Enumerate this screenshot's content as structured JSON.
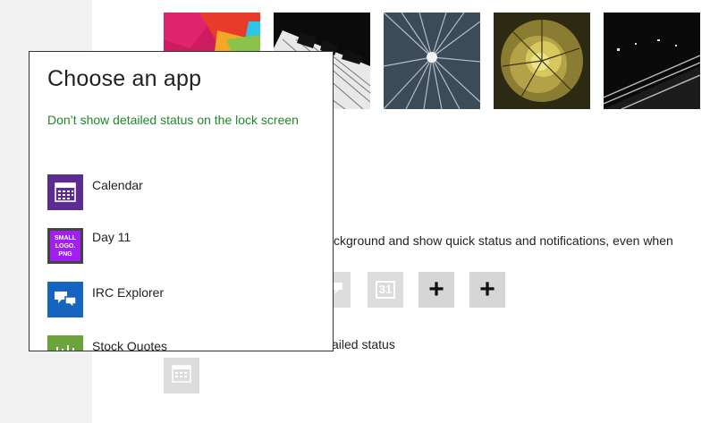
{
  "background": {
    "images": [
      {
        "name": "abstract-shapes"
      },
      {
        "name": "piano-keys"
      },
      {
        "name": "city-light-trails"
      },
      {
        "name": "nautilus-shell"
      },
      {
        "name": "night-road"
      }
    ],
    "description_fragment": "ckground and show quick status and notifications, even when",
    "detailed_status_fragment": "ailed status",
    "quick_status_tiles": [
      {
        "icon": "chat-icon"
      },
      {
        "icon": "calendar-31-icon",
        "label": "31"
      },
      {
        "icon": "plus-icon",
        "label": "+"
      },
      {
        "icon": "plus-icon",
        "label": "+"
      }
    ],
    "detailed_status_tile_icon": "calendar-icon"
  },
  "flyout": {
    "title": "Choose an app",
    "dont_show_link": "Don’t show detailed status on the lock screen",
    "apps": [
      {
        "label": "Calendar",
        "icon": "calendar-icon",
        "color": "#5c2d91"
      },
      {
        "label": "Day 11",
        "icon": "small-logo-icon",
        "color": "#444444",
        "icon_text": "SMALL LOGO. PNG"
      },
      {
        "label": "IRC Explorer",
        "icon": "chat-bubbles-icon",
        "color": "#1565c0"
      },
      {
        "label": "Stock Quotes",
        "icon": "stock-chart-icon",
        "color": "#6aa43a"
      }
    ]
  }
}
